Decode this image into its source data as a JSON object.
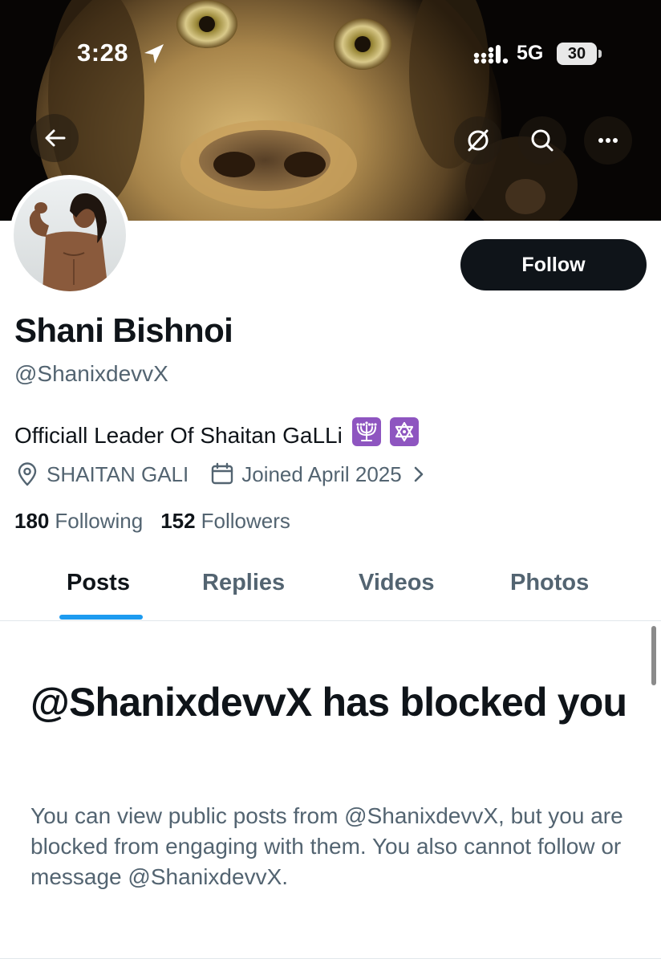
{
  "status_bar": {
    "time": "3:28",
    "network": "5G",
    "battery": "30",
    "icons": [
      "location-arrow-icon",
      "signal-icon",
      "battery-icon"
    ]
  },
  "nav": {
    "icons": [
      "back-arrow-icon",
      "grok-icon",
      "search-icon",
      "more-icon"
    ]
  },
  "profile": {
    "display_name": "Shani Bishnoi",
    "handle": "@ShanixdevvX",
    "bio": "Officiall Leader Of Shaitan GaLLi",
    "bio_emojis": [
      "menorah-emoji",
      "star-of-david-emoji"
    ],
    "location": "SHAITAN GALI",
    "joined": "Joined April 2025",
    "following_count": "180",
    "following_label": "Following",
    "followers_count": "152",
    "followers_label": "Followers",
    "follow_button": "Follow"
  },
  "tabs": [
    {
      "label": "Posts",
      "active": true
    },
    {
      "label": "Replies",
      "active": false
    },
    {
      "label": "Videos",
      "active": false
    },
    {
      "label": "Photos",
      "active": false
    }
  ],
  "blocked": {
    "title": "@ShanixdevvX has blocked you",
    "description": "You can view public posts from @ShanixdevvX, but you are blocked from engaging with them. You also cannot follow or message @ShanixdevvX."
  },
  "colors": {
    "primary_text": "#0f1419",
    "secondary_text": "#536471",
    "accent": "#1d9bf0",
    "button_bg": "#0f1419",
    "divider": "#e1e7eb"
  }
}
